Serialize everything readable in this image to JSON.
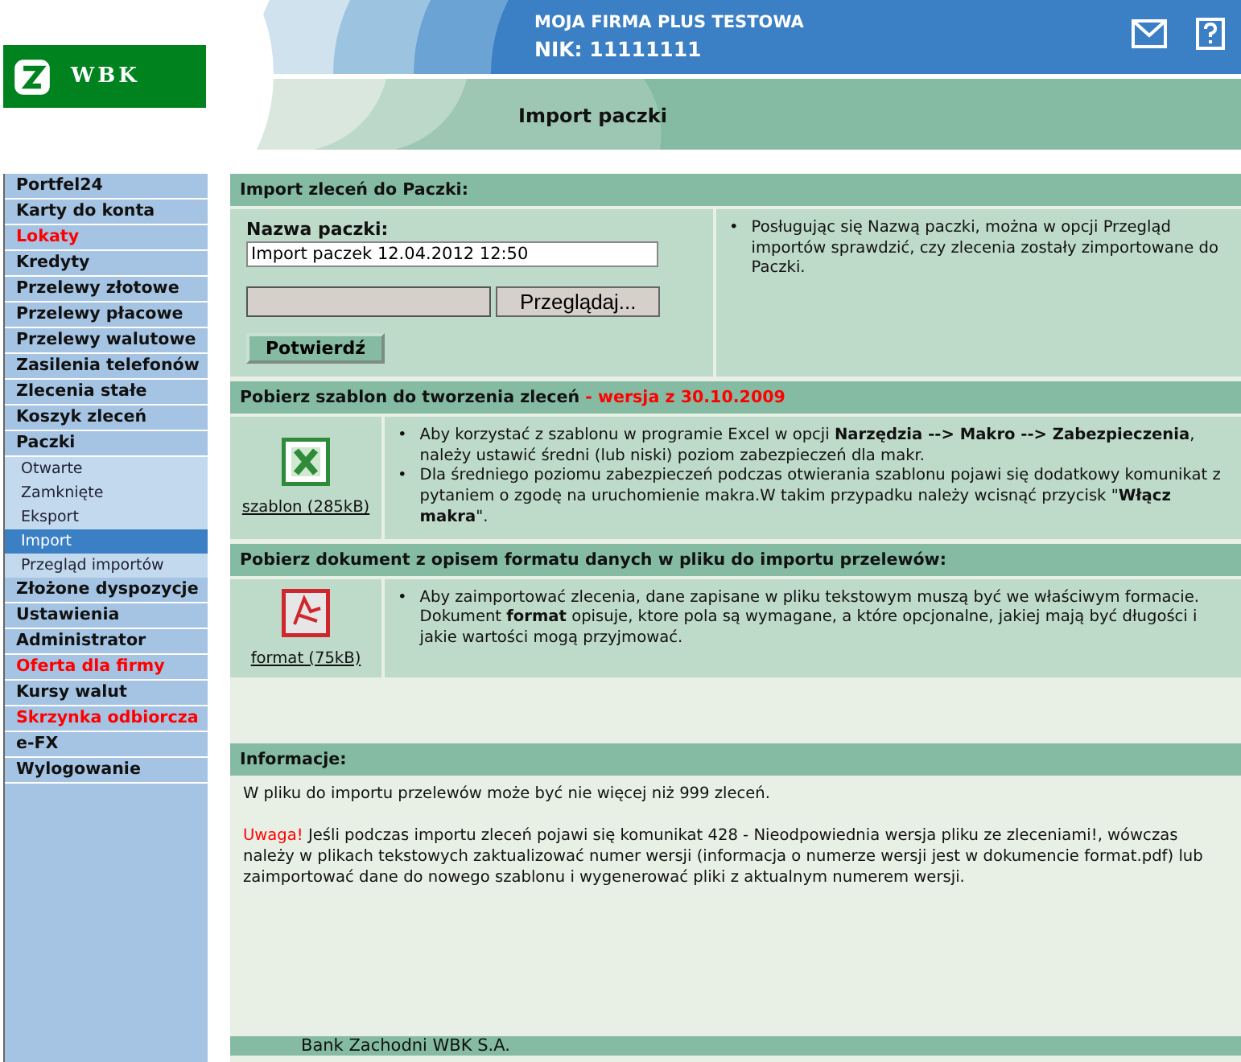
{
  "header": {
    "logo_text": "WBK",
    "company": "MOJA FIRMA PLUS TESTOWA",
    "nik": "NIK: 11111111",
    "page_title": "Import paczki"
  },
  "menu": [
    {
      "label": "Portfel24",
      "highlighted": false
    },
    {
      "label": "Karty do konta",
      "highlighted": false
    },
    {
      "label": "Lokaty",
      "highlighted": true
    },
    {
      "label": "Kredyty",
      "highlighted": false
    },
    {
      "label": "Przelewy złotowe",
      "highlighted": false
    },
    {
      "label": "Przelewy płacowe",
      "highlighted": false
    },
    {
      "label": "Przelewy walutowe",
      "highlighted": false
    },
    {
      "label": "Zasilenia telefonów",
      "highlighted": false
    },
    {
      "label": "Zlecenia stałe",
      "highlighted": false
    },
    {
      "label": "Koszyk zleceń",
      "highlighted": false
    },
    {
      "label": "Paczki",
      "highlighted": false,
      "children": [
        {
          "label": "Otwarte",
          "selected": false
        },
        {
          "label": "Zamknięte",
          "selected": false
        },
        {
          "label": "Eksport",
          "selected": false
        },
        {
          "label": "Import",
          "selected": true
        },
        {
          "label": "Przegląd importów",
          "selected": false
        }
      ]
    },
    {
      "label": "Złożone dyspozycje",
      "highlighted": false
    },
    {
      "label": "Ustawienia",
      "highlighted": false
    },
    {
      "label": "Administrator",
      "highlighted": false
    },
    {
      "label": "Oferta dla firmy",
      "highlighted": true
    },
    {
      "label": "Kursy walut",
      "highlighted": false
    },
    {
      "label": "Skrzynka odbiorcza",
      "highlighted": true
    },
    {
      "label": "e-FX",
      "highlighted": false
    },
    {
      "label": "Wylogowanie",
      "highlighted": false
    }
  ],
  "import_section": {
    "title": "Import zleceń do Paczki:",
    "name_label": "Nazwa paczki:",
    "name_value": "Import paczek 12.04.2012 12:50",
    "browse_button": "Przeglądaj...",
    "confirm_button": "Potwierdź",
    "hint": "Posługując się Nazwą paczki, można w opcji Przegląd importów sprawdzić, czy zlecenia zostały zimportowane do Paczki."
  },
  "template_section": {
    "title": "Pobierz szablon do tworzenia zleceń",
    "version_note": " - wersja z 30.10.2009",
    "link": "szablon (285kB)",
    "bullets": [
      "Aby korzystać z szablonu w programie Excel w opcji **Narzędzia --> Makro --> Zabezpieczenia**, należy ustawić średni (lub niski) poziom zabezpieczeń dla makr.",
      "Dla średniego poziomu zabezpieczeń podczas otwierania szablonu pojawi się dodatkowy komunikat z pytaniem o zgodę na uruchomienie makra.W takim przypadku należy wcisnąć przycisk \"**Włącz makra**\"."
    ]
  },
  "format_section": {
    "title": "Pobierz dokument z opisem formatu danych w pliku do importu przelewów:",
    "link": "format (75kB)",
    "bullets": [
      "Aby zaimportować zlecenia, dane zapisane w pliku tekstowym muszą być we właściwym formacie. Dokument **format** opisuje, ktore pola są wymagane, a które opcjonalne, jakiej mają być długości i jakie wartości mogą przyjmować."
    ]
  },
  "info_section": {
    "title": "Informacje:",
    "text": "W pliku do importu przelewów może być nie więcej niż 999 zleceń.",
    "warning_label": "Uwaga!",
    "warning_text": " Jeśli podczas importu zleceń pojawi się komunikat 428 - Nieodpowiednia wersja pliku ze zleceniami!, wówczas należy w plikach tekstowych zaktualizować numer wersji (informacja o numerze wersji jest w dokumencie format.pdf) lub zaimportować dane do nowego szablonu i wygenerować pliki z aktualnym numerem wersji."
  },
  "bullet_marker": "•",
  "footer": "Bank Zachodni WBK S.A."
}
